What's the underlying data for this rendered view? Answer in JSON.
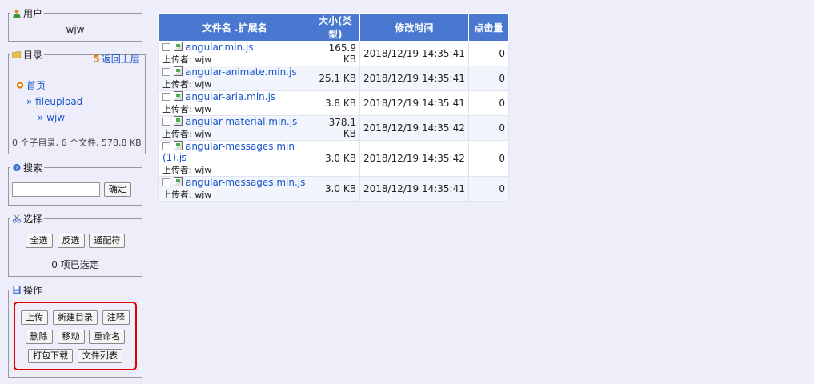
{
  "user": {
    "legend": "用户",
    "name": "wjw"
  },
  "directory": {
    "legend": "目录",
    "back_number": "5",
    "back_label": "返回上层",
    "items": [
      {
        "label": "首页"
      },
      {
        "label": "» fileupload"
      },
      {
        "label": "» wjw"
      }
    ],
    "summary": "0 个子目录, 6 个文件, 578.8 KB"
  },
  "search": {
    "legend": "搜索",
    "value": "",
    "confirm_label": "确定"
  },
  "select": {
    "legend": "选择",
    "buttons": [
      "全选",
      "反选",
      "通配符"
    ],
    "status": "0 项已选定"
  },
  "operations": {
    "legend": "操作",
    "row1": [
      "上传",
      "新建目录",
      "注释"
    ],
    "row2": [
      "删除",
      "移动",
      "重命名"
    ],
    "row3": [
      "打包下载",
      "文件列表"
    ]
  },
  "table": {
    "headers": [
      "文件名 .扩展名",
      "大小(类型)",
      "修改时间",
      "点击量"
    ],
    "uploader_prefix": "上传者: ",
    "rows": [
      {
        "name": "angular.min.js",
        "uploader": "wjw",
        "size": "165.9 KB",
        "time": "2018/12/19 14:35:41",
        "clicks": "0"
      },
      {
        "name": "angular-animate.min.js",
        "uploader": "wjw",
        "size": "25.1 KB",
        "time": "2018/12/19 14:35:41",
        "clicks": "0"
      },
      {
        "name": "angular-aria.min.js",
        "uploader": "wjw",
        "size": "3.8 KB",
        "time": "2018/12/19 14:35:41",
        "clicks": "0"
      },
      {
        "name": "angular-material.min.js",
        "uploader": "wjw",
        "size": "378.1 KB",
        "time": "2018/12/19 14:35:42",
        "clicks": "0"
      },
      {
        "name": "angular-messages.min (1).js",
        "uploader": "wjw",
        "size": "3.0 KB",
        "time": "2018/12/19 14:35:42",
        "clicks": "0"
      },
      {
        "name": "angular-messages.min.js",
        "uploader": "wjw",
        "size": "3.0 KB",
        "time": "2018/12/19 14:35:41",
        "clicks": "0"
      }
    ]
  },
  "colors": {
    "header_bg": "#4a78d0",
    "link": "#1a55c8",
    "page_bg": "#eeeefb",
    "highlight": "#e00000"
  }
}
